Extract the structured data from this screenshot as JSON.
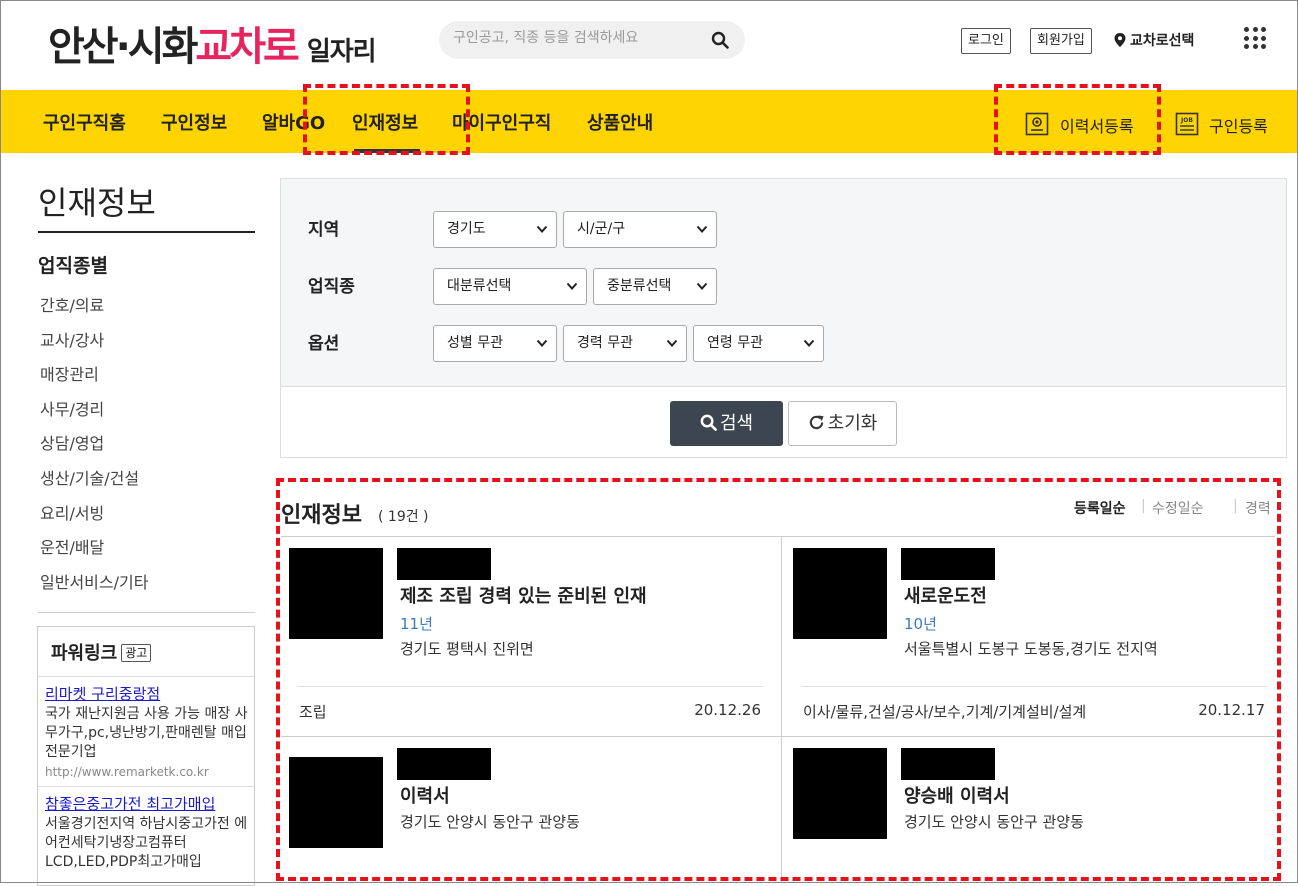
{
  "header": {
    "logo": {
      "part1": "안산·시화",
      "part2": "교차로",
      "part3": "일자리"
    },
    "search_placeholder": "구인공고, 직종 등을 검색하세요",
    "login": "로그인",
    "signup": "회원가입",
    "location": "교차로선택"
  },
  "nav": {
    "items": [
      "구인구직홈",
      "구인정보",
      "알바GO",
      "인재정보",
      "마이구인구직",
      "상품안내"
    ],
    "active": "인재정보",
    "resume_register": "이력서등록",
    "job_register": "구인등록"
  },
  "sidebar": {
    "title": "인재정보",
    "subtitle": "업직종별",
    "categories": [
      "간호/의료",
      "교사/강사",
      "매장관리",
      "사무/경리",
      "상담/영업",
      "생산/기술/건설",
      "요리/서빙",
      "운전/배달",
      "일반서비스/기타"
    ],
    "powerlink": {
      "title": "파워링크",
      "ad_badge": "광고",
      "ads": [
        {
          "link": "리마켓 구리중랑점",
          "desc": "국가 재난지원금 사용 가능 매장 사무가구,pc,냉난방기,판매렌탈 매입 전문기업",
          "url": "http://www.remarketk.co.kr"
        },
        {
          "link": "참좋은중고가전 최고가매입",
          "desc": "서울경기전지역 하남시중고가전 에어컨세탁기냉장고컴퓨터LCD,LED,PDP최고가매입",
          "url": ""
        }
      ]
    }
  },
  "filter": {
    "labels": {
      "region": "지역",
      "job": "업직종",
      "option": "옵션"
    },
    "region": {
      "province": "경기도",
      "city": "시/군/구"
    },
    "job": {
      "major": "대분류선택",
      "middle": "중분류선택"
    },
    "option": {
      "gender": "성별 무관",
      "career": "경력 무관",
      "age": "연령 무관"
    },
    "search_button": "검색",
    "reset_button": "초기화"
  },
  "results": {
    "title": "인재정보",
    "count": "( 19건 )",
    "sort": [
      "등록일순",
      "수정일순",
      "경력"
    ],
    "active_sort": "등록일순",
    "cards": [
      {
        "title": "제조 조립 경력 있는 준비된 인재",
        "career": "11년",
        "region": "경기도 평택시 진위면",
        "tags": "조립",
        "date": "20.12.26"
      },
      {
        "title": "새로운도전",
        "career": "10년",
        "region": "서울특별시 도봉구 도봉동,경기도 전지역",
        "tags": "이사/물류,건설/공사/보수,기계/기계설비/설계",
        "date": "20.12.17"
      },
      {
        "title": "이력서",
        "career": "",
        "region": "경기도 안양시 동안구 관양동",
        "tags": "",
        "date": ""
      },
      {
        "title": "양승배 이력서",
        "career": "",
        "region": "경기도 안양시 동안구 관양동",
        "tags": "",
        "date": ""
      }
    ]
  },
  "colors": {
    "nav_bg": "#ffd400",
    "logo_accent": "#e6245e",
    "highlight": "#e6121b",
    "search_button": "#3d4650",
    "career_text": "#3b7bbf"
  }
}
